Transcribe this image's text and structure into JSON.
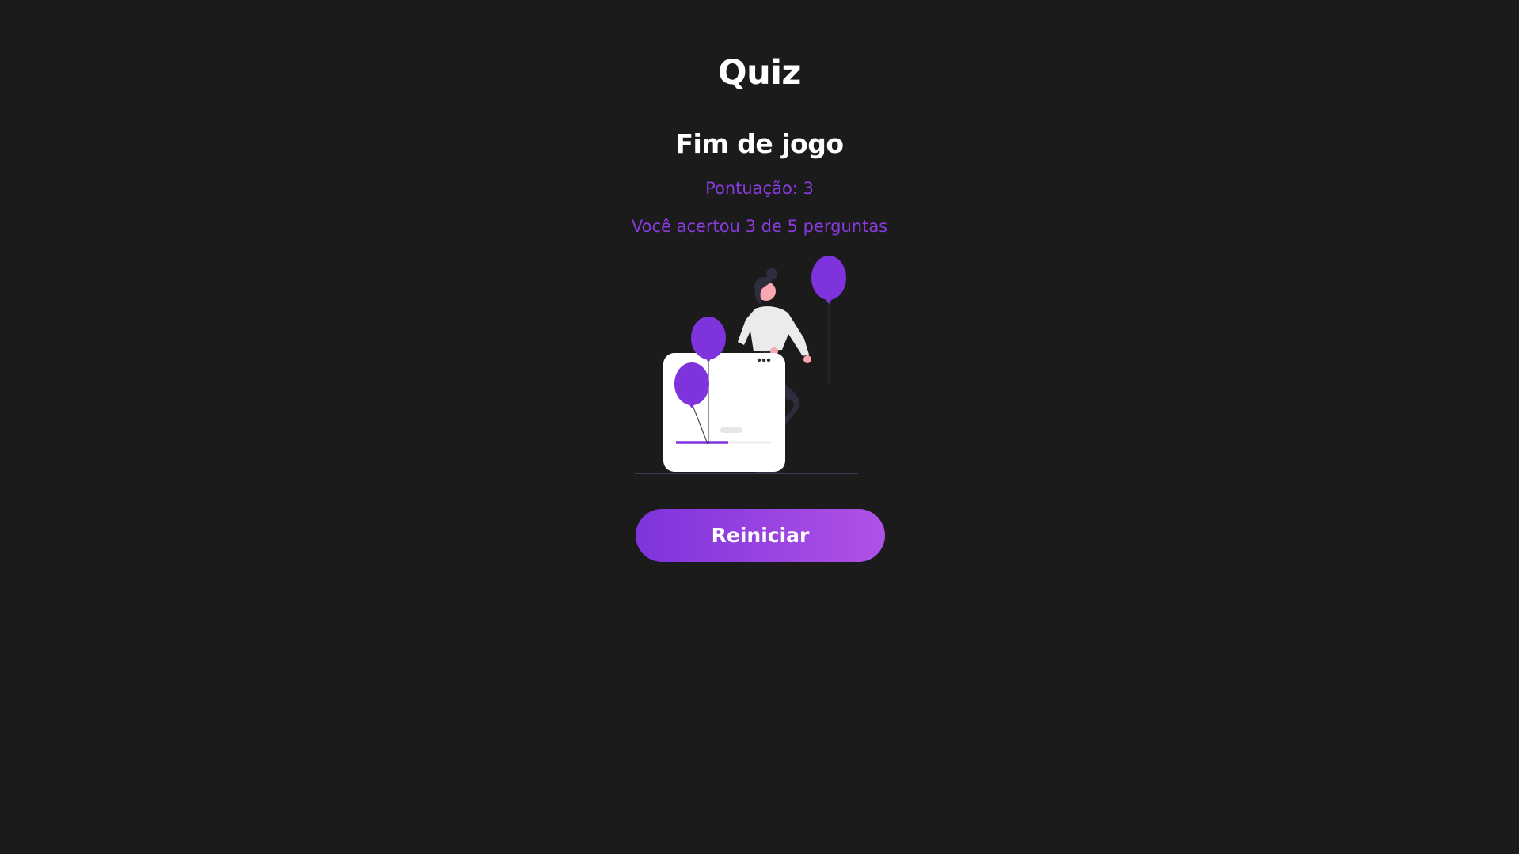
{
  "app": {
    "title": "Quiz"
  },
  "result": {
    "heading": "Fim de jogo",
    "score_text": "Pontuação: 3",
    "summary_text": "Você acertou 3 de 5 perguntas"
  },
  "actions": {
    "restart_label": "Reiniciar"
  },
  "colors": {
    "background": "#1b1b1c",
    "accent": "#8a3be0",
    "button_gradient_start": "#7e33dc",
    "button_gradient_end": "#b052e6",
    "text_primary": "#ffffff"
  },
  "illustration": {
    "name": "celebration-illustration",
    "progress_fraction": 0.55
  }
}
